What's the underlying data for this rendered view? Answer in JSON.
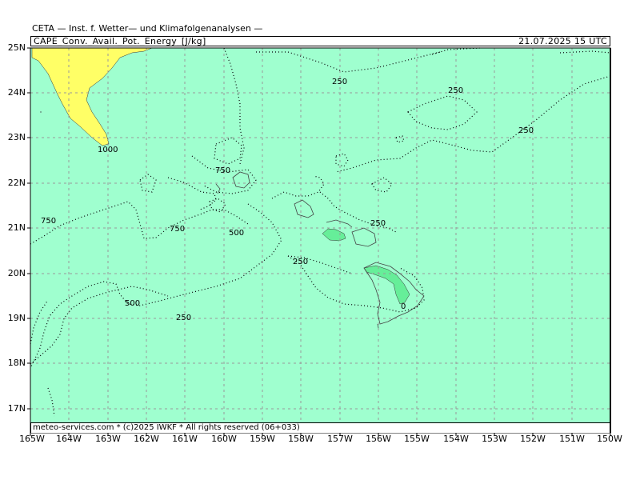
{
  "header": {
    "title": "CETA — Inst. f. Wetter— und Klimafolgenanalysen —"
  },
  "info_bar": {
    "left": "CAPE_Conv._Avail._Pot._Energy_[J/kg]",
    "right": "21.07.2025 15 UTC"
  },
  "footer": {
    "text": "meteo-services.com * (c)2025 IWKF * All rights reserved (06+033)"
  },
  "axes": {
    "lat_labels": [
      "25N",
      "24N",
      "23N",
      "22N",
      "21N",
      "20N",
      "19N",
      "18N",
      "17N"
    ],
    "lon_labels": [
      "165W",
      "164W",
      "163W",
      "162W",
      "161W",
      "160W",
      "159W",
      "158W",
      "157W",
      "156W",
      "155W",
      "154W",
      "153W",
      "152W",
      "151W",
      "150W"
    ]
  },
  "contour_labels": [
    "250",
    "250",
    "250",
    "1000",
    "750",
    "750",
    "750",
    "500",
    "250",
    "250",
    "500",
    "250",
    "0"
  ],
  "colors": {
    "background": "#9fffcf",
    "cape_1000": "#ffff66",
    "cape_low": "#66ee99",
    "grid": "#999999"
  }
}
